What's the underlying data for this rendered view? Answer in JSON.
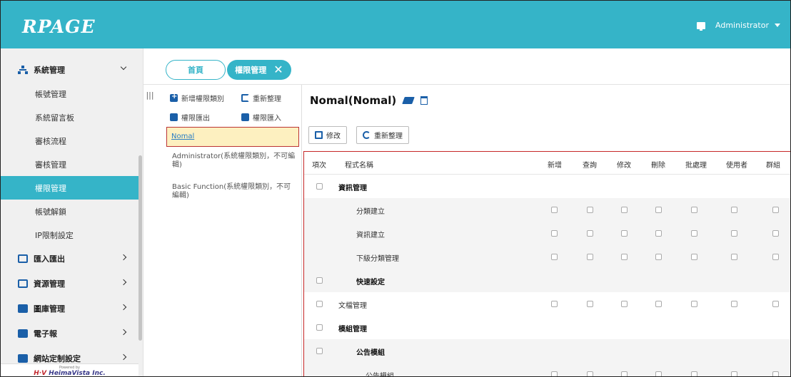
{
  "header": {
    "logo": "RPAGE",
    "user": "Administrator"
  },
  "sidebar": {
    "groups": [
      {
        "label": "系統管理",
        "icon": "network-icon",
        "expanded": true
      },
      {
        "label": "匯入匯出",
        "icon": "import-export-icon"
      },
      {
        "label": "資源管理",
        "icon": "resource-icon"
      },
      {
        "label": "圖庫管理",
        "icon": "gallery-icon"
      },
      {
        "label": "電子報",
        "icon": "newsletter-icon"
      },
      {
        "label": "網站定制設定",
        "icon": "site-settings-icon"
      }
    ],
    "items": [
      "帳號管理",
      "系統留言板",
      "審核流程",
      "審核管理",
      "權限管理",
      "帳號解鎖",
      "IP限制設定"
    ],
    "active_item": "權限管理",
    "powered_by": "Powered by",
    "powered_brand": "HeimaVista Inc."
  },
  "tabs": {
    "home": "首頁",
    "active": "權限管理"
  },
  "tree": {
    "buttons": {
      "add": "新增權限類別",
      "refresh": "重新整理",
      "export": "權限匯出",
      "import": "權限匯入"
    },
    "selected": "Nomal",
    "items": [
      "Administrator(系統權限類別，不可編輯)",
      "Basic Function(系統權限類別，不可編輯)"
    ]
  },
  "detail": {
    "title": "Nomal(Nomal)",
    "buttons": {
      "edit": "修改",
      "refresh": "重新整理"
    },
    "columns": [
      "項次",
      "程式名稱",
      "新增",
      "查詢",
      "修改",
      "刪除",
      "批處理",
      "使用者",
      "群組"
    ],
    "rows": [
      {
        "name": "資訊管理",
        "level": 0,
        "perms": false
      },
      {
        "name": "分類建立",
        "level": 1,
        "perms": true
      },
      {
        "name": "資訊建立",
        "level": 1,
        "perms": true
      },
      {
        "name": "下級分類管理",
        "level": 1,
        "perms": true
      },
      {
        "name": "快速設定",
        "level": 1,
        "perms": false,
        "bold": true
      },
      {
        "name": "文檔管理",
        "level": 0,
        "perms": true,
        "bold": false
      },
      {
        "name": "模組管理",
        "level": 0,
        "perms": false
      },
      {
        "name": "公告模組",
        "level": 1,
        "perms": false,
        "bold": true
      },
      {
        "name": "公告模組",
        "level": 2,
        "perms": true
      }
    ]
  },
  "colors": {
    "accent": "#35b4c8",
    "highlight_border": "#c62828",
    "selected_bg": "#fdf0c0"
  }
}
